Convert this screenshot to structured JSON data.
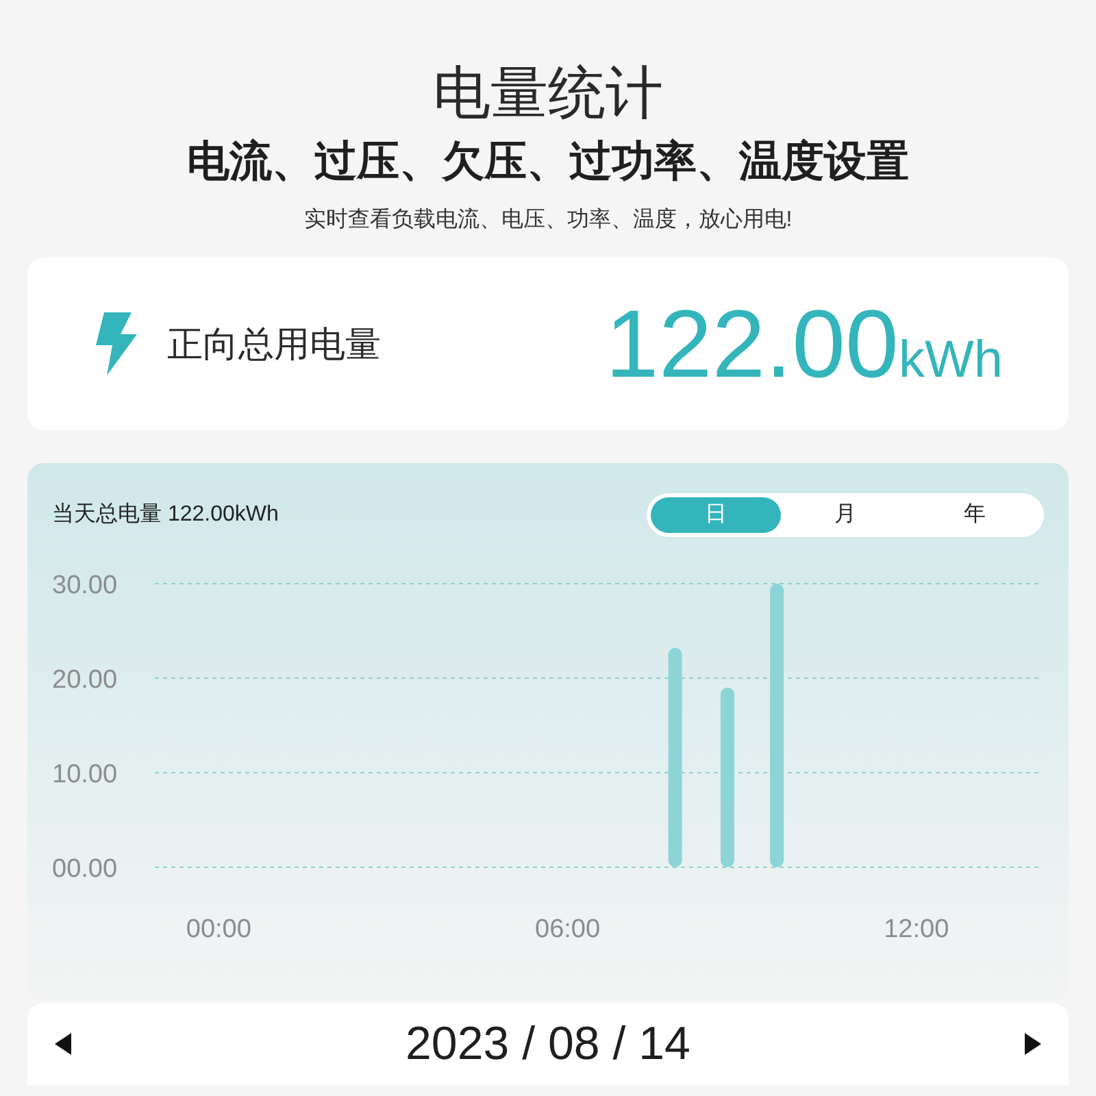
{
  "header": {
    "title": "电量统计",
    "subtitle": "电流、过压、欠压、过功率、温度设置",
    "description": "实时查看负载电流、电压、功率、温度，放心用电!"
  },
  "total_card": {
    "label": "正向总用电量",
    "value": "122.00",
    "unit": "kWh"
  },
  "chart_panel": {
    "summary": "当天总电量 122.00kWh",
    "tabs": [
      {
        "label": "日",
        "selected": true
      },
      {
        "label": "月",
        "selected": false
      },
      {
        "label": "年",
        "selected": false
      }
    ],
    "chart_data": {
      "type": "bar",
      "x": [
        7.85,
        8.75,
        9.6
      ],
      "series": [
        {
          "color": "#8dd4d6",
          "values": [
            23.2,
            19.0,
            30.0
          ]
        }
      ],
      "xlim": [
        -1.1,
        14.1
      ],
      "ylim": [
        0,
        30
      ],
      "grid": true,
      "xticks": [
        {
          "value": 0,
          "label": "00:00"
        },
        {
          "value": 6,
          "label": "06:00"
        },
        {
          "value": 12,
          "label": "12:00"
        }
      ],
      "yticks": [
        {
          "value": 0,
          "label": "00.00"
        },
        {
          "value": 10,
          "label": "10.00"
        },
        {
          "value": 20,
          "label": "20.00"
        },
        {
          "value": 30,
          "label": "30.00"
        }
      ]
    }
  },
  "date_bar": {
    "date": "2023 / 08 / 14"
  }
}
